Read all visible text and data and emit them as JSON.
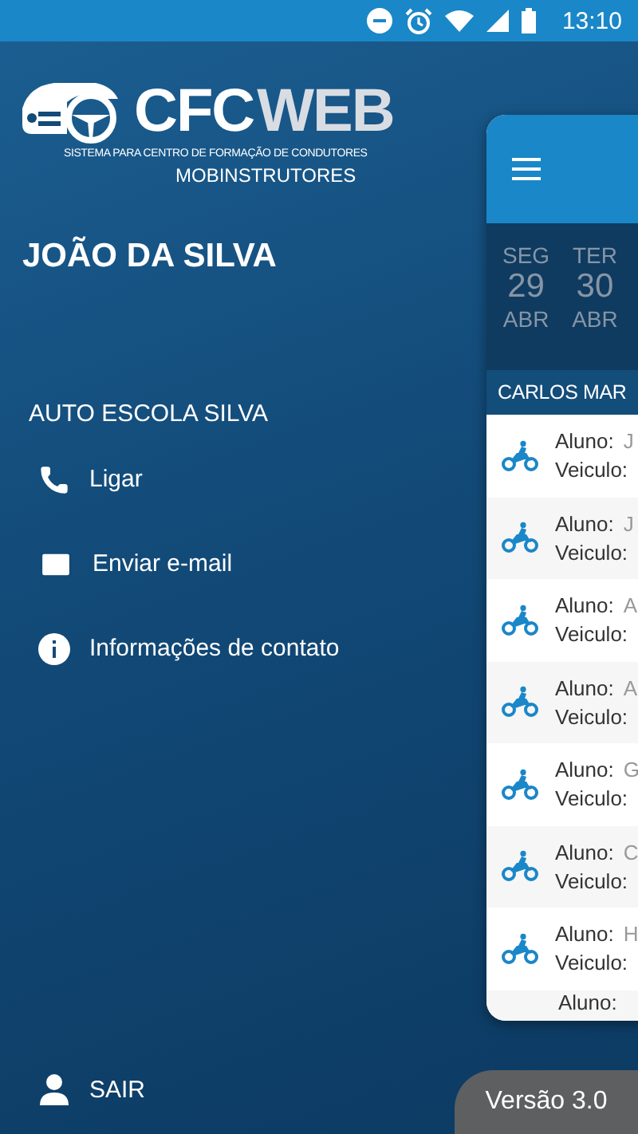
{
  "status_bar": {
    "time": "13:10"
  },
  "logo": {
    "brand_a": "CFC",
    "brand_b": "WEB",
    "tagline": "SISTEMA PARA CENTRO DE FORMAÇÃO DE CONDUTORES",
    "product": "MOBINSTRUTORES"
  },
  "user_name": "JOÃO DA SILVA",
  "school": {
    "name": "AUTO ESCOLA SILVA",
    "actions": [
      {
        "kind": "phone",
        "label": "Ligar"
      },
      {
        "kind": "mail",
        "label": "Enviar e-mail"
      },
      {
        "kind": "info",
        "label": "Informações de contato"
      }
    ]
  },
  "logout": {
    "label": "SAIR"
  },
  "schedule": {
    "days": [
      {
        "weekday": "SEG",
        "day": "29",
        "month": "ABR"
      },
      {
        "weekday": "TER",
        "day": "30",
        "month": "ABR"
      }
    ],
    "instructor": "CARLOS MAR",
    "rows": [
      {
        "student_label": "Aluno:",
        "student": "J",
        "vehicle_label": "Veiculo:"
      },
      {
        "student_label": "Aluno:",
        "student": "J",
        "vehicle_label": "Veiculo:"
      },
      {
        "student_label": "Aluno:",
        "student": "A",
        "vehicle_label": "Veiculo:"
      },
      {
        "student_label": "Aluno:",
        "student": "A",
        "vehicle_label": "Veiculo:"
      },
      {
        "student_label": "Aluno:",
        "student": "G",
        "vehicle_label": "Veiculo:"
      },
      {
        "student_label": "Aluno:",
        "student": "C",
        "vehicle_label": "Veiculo:"
      },
      {
        "student_label": "Aluno:",
        "student": "H",
        "vehicle_label": "Veiculo:"
      },
      {
        "student_label": "Aluno:"
      }
    ]
  },
  "version": "Versão 3.0"
}
